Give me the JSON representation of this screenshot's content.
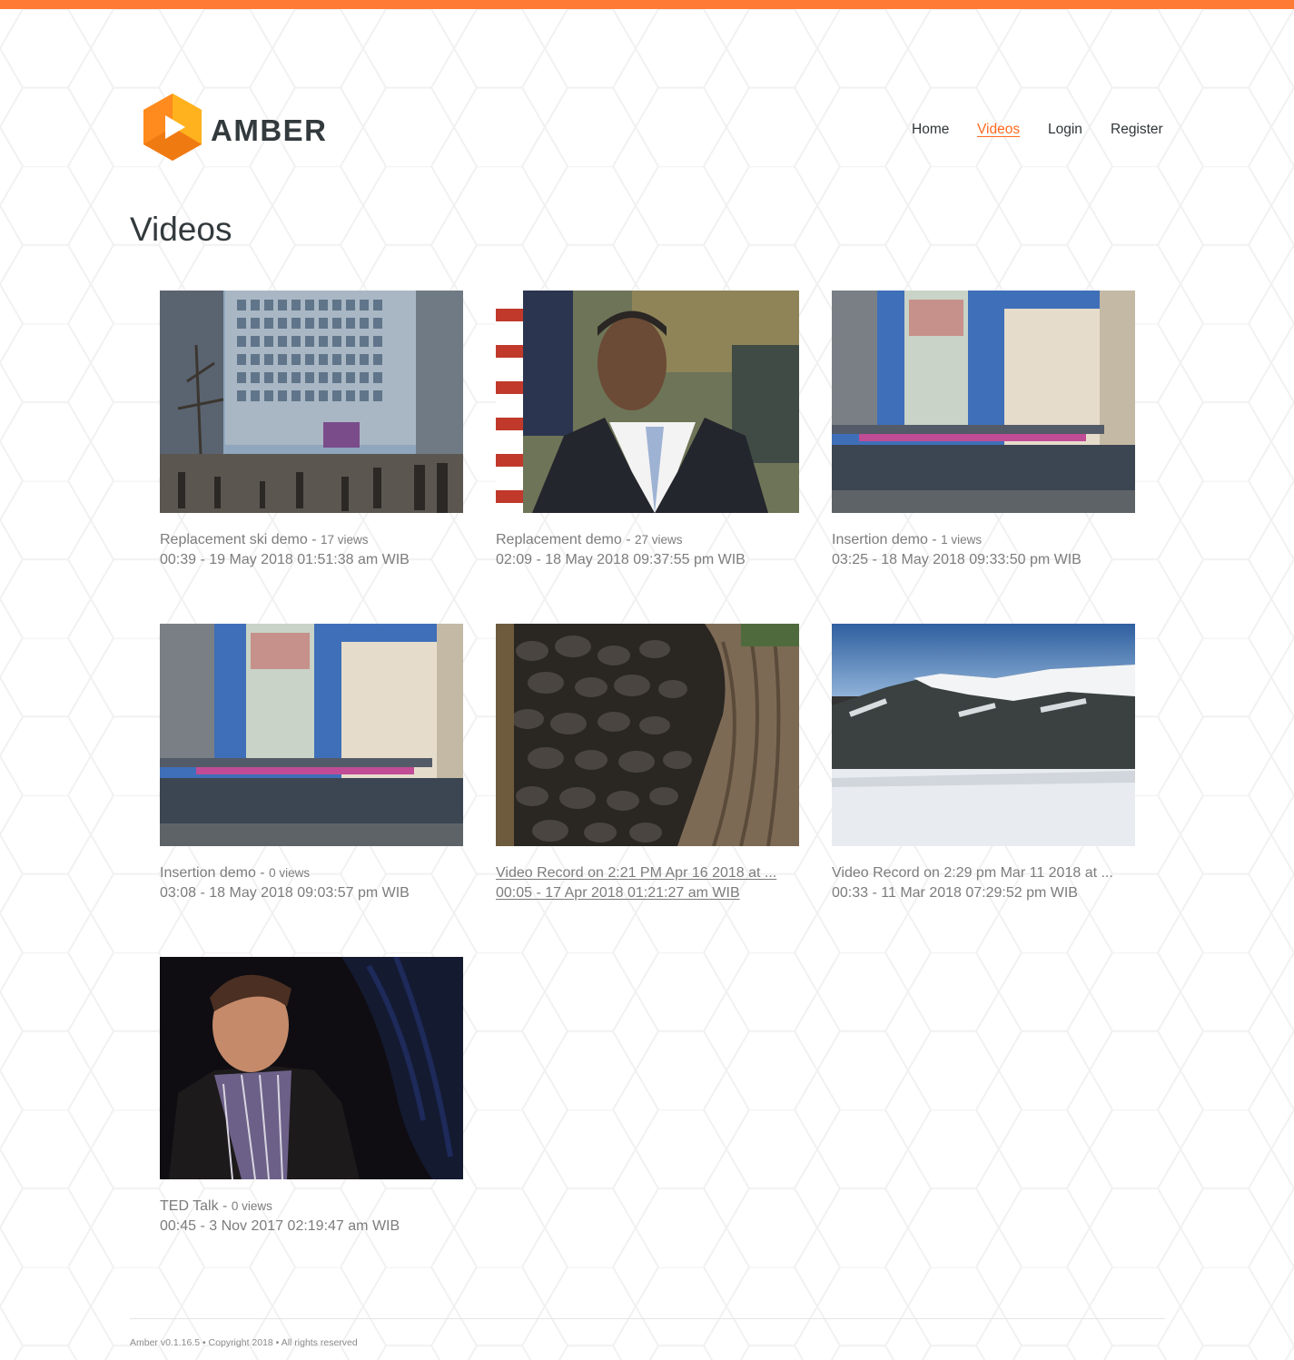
{
  "brand": {
    "name": "AMBER",
    "primary_color": "#ff7b35",
    "logo_icon": "hexagon-play-icon"
  },
  "nav": [
    {
      "label": "Home",
      "active": false
    },
    {
      "label": "Videos",
      "active": true
    },
    {
      "label": "Login",
      "active": false
    },
    {
      "label": "Register",
      "active": false
    }
  ],
  "page": {
    "title": "Videos"
  },
  "videos": [
    {
      "title": "Replacement ski demo - ",
      "views": "17 views",
      "meta": "00:39 - 19 May 2018 01:51:38 am WIB",
      "thumbnail": "city-plaza-crowd"
    },
    {
      "title": "Replacement demo - ",
      "views": "27 views",
      "meta": "02:09 - 18 May 2018 09:37:55 pm WIB",
      "thumbnail": "man-in-suit-speaking"
    },
    {
      "title": "Insertion demo - ",
      "views": "1 views",
      "meta": "03:25 - 18 May 2018 09:33:50 pm WIB",
      "thumbnail": "canal-bridge-towers"
    },
    {
      "title": "Insertion demo - ",
      "views": "0 views",
      "meta": "03:08 - 18 May 2018 09:03:57 pm WIB",
      "thumbnail": "canal-bridge-towers"
    },
    {
      "title": "Video Record on 2:21 PM Apr 16 2018 at ...",
      "views": "",
      "meta": "00:05 - 17 Apr 2018 01:21:27 am WIB",
      "thumbnail": "stone-wall-tree"
    },
    {
      "title": "Video Record on 2:29 pm Mar 11 2018 at ...",
      "views": "",
      "meta": "00:33 - 11 Mar 2018 07:29:52 pm WIB",
      "thumbnail": "snowy-mountain"
    },
    {
      "title": "TED Talk - ",
      "views": "0 views",
      "meta": "00:45 - 3 Nov 2017 02:19:47 am WIB",
      "thumbnail": "man-on-dark-stage"
    }
  ],
  "footer": {
    "text": "Amber v0.1.16.5 • Copyright 2018 • All rights reserved"
  }
}
